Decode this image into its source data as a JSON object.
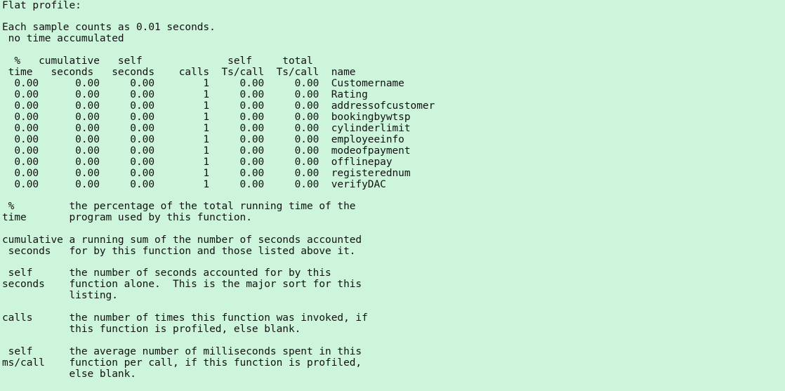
{
  "title": "Flat profile:",
  "intro": [
    "Each sample counts as 0.01 seconds.",
    " no time accumulated"
  ],
  "header_lines": [
    "  %   cumulative   self              self     total",
    " time   seconds   seconds    calls  Ts/call  Ts/call  name"
  ],
  "table_rows": [
    "  0.00      0.00     0.00        1     0.00     0.00  Customername",
    "  0.00      0.00     0.00        1     0.00     0.00  Rating",
    "  0.00      0.00     0.00        1     0.00     0.00  addressofcustomer",
    "  0.00      0.00     0.00        1     0.00     0.00  bookingbywtsp",
    "  0.00      0.00     0.00        1     0.00     0.00  cylinderlimit",
    "  0.00      0.00     0.00        1     0.00     0.00  employeeinfo",
    "  0.00      0.00     0.00        1     0.00     0.00  modeofpayment",
    "  0.00      0.00     0.00        1     0.00     0.00  offlinepay",
    "  0.00      0.00     0.00        1     0.00     0.00  registerednum",
    "  0.00      0.00     0.00        1     0.00     0.00  verifyDAC"
  ],
  "explanations": [
    [
      " %         the percentage of the total running time of the",
      "time       program used by this function."
    ],
    [
      "cumulative a running sum of the number of seconds accounted",
      " seconds   for by this function and those listed above it."
    ],
    [
      " self      the number of seconds accounted for by this",
      "seconds    function alone.  This is the major sort for this",
      "           listing."
    ],
    [
      "calls      the number of times this function was invoked, if",
      "           this function is profiled, else blank."
    ],
    [
      " self      the average number of milliseconds spent in this",
      "ms/call    function per call, if this function is profiled,",
      "           else blank."
    ]
  ]
}
